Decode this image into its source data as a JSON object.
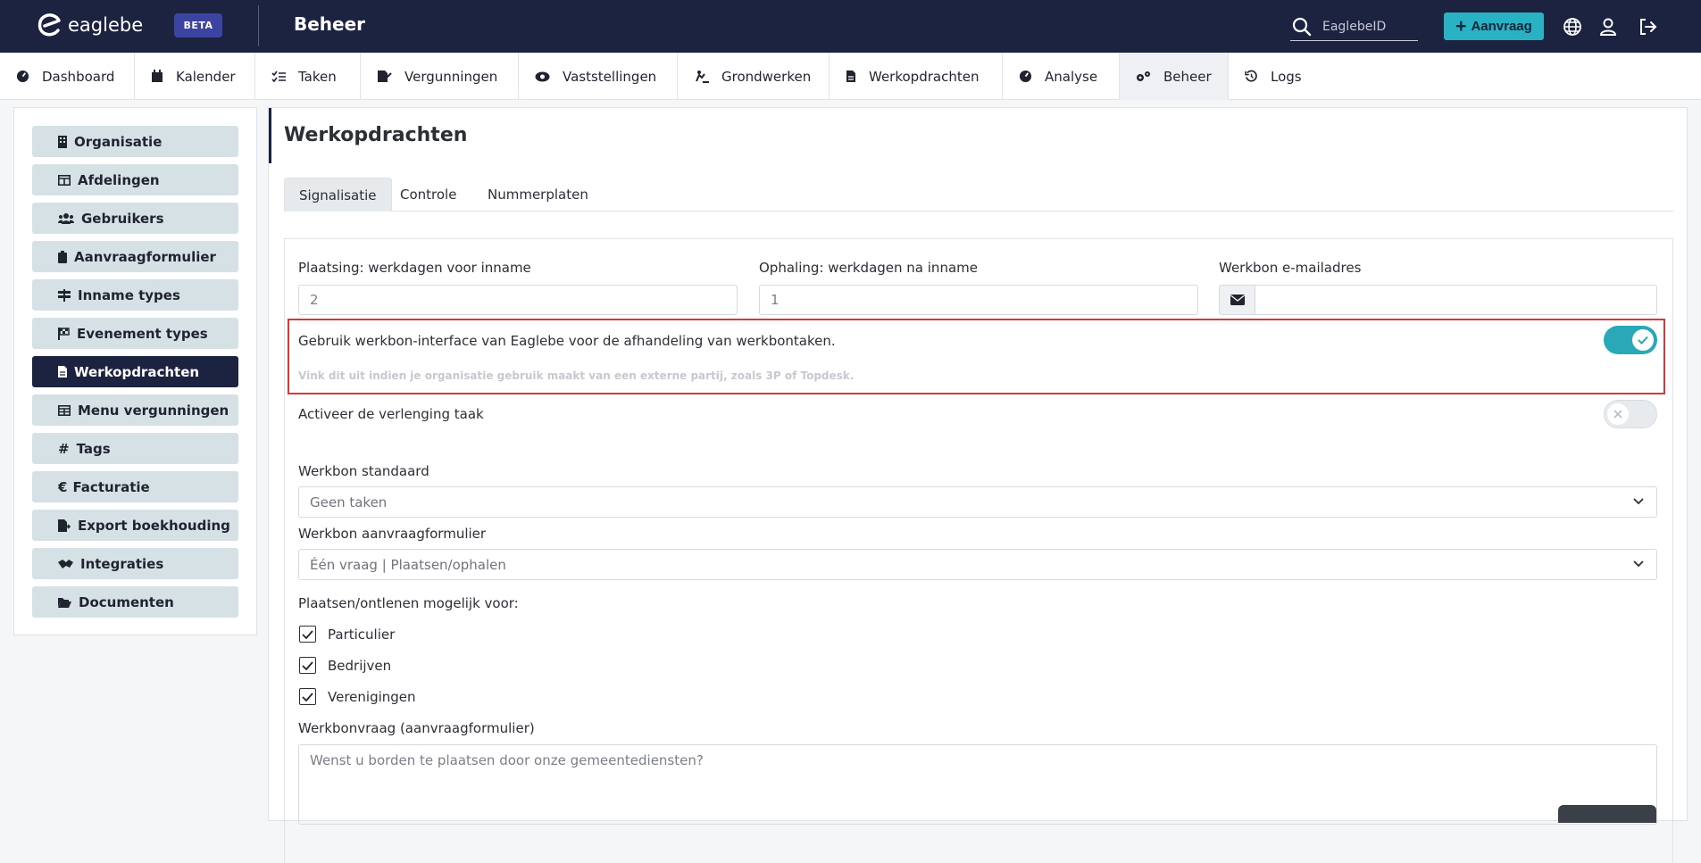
{
  "topbar": {
    "brand": "eaglebe",
    "beta": "BETA",
    "title": "Beheer",
    "search_placeholder": "EaglebeID",
    "aanvraag_label": "Aanvraag"
  },
  "nav": [
    {
      "label": "Dashboard",
      "icon": "gauge-icon"
    },
    {
      "label": "Kalender",
      "icon": "calendar-icon"
    },
    {
      "label": "Taken",
      "icon": "tasks-icon"
    },
    {
      "label": "Vergunningen",
      "icon": "file-signature-icon"
    },
    {
      "label": "Vaststellingen",
      "icon": "eye-icon"
    },
    {
      "label": "Grondwerken",
      "icon": "digging-icon"
    },
    {
      "label": "Werkopdrachten",
      "icon": "document-icon"
    },
    {
      "label": "Analyse",
      "icon": "gauge-icon"
    },
    {
      "label": "Beheer",
      "icon": "cogs-icon",
      "active": true
    },
    {
      "label": "Logs",
      "icon": "history-icon"
    }
  ],
  "sidebar": [
    {
      "label": "Organisatie",
      "icon": "building-icon"
    },
    {
      "label": "Afdelingen",
      "icon": "table-icon"
    },
    {
      "label": "Gebruikers",
      "icon": "users-icon"
    },
    {
      "label": "Aanvraagformulier",
      "icon": "clipboard-icon"
    },
    {
      "label": "Inname types",
      "icon": "signs-icon"
    },
    {
      "label": "Evenement types",
      "icon": "flag-icon"
    },
    {
      "label": "Werkopdrachten",
      "icon": "document-icon",
      "active": true
    },
    {
      "label": "Menu vergunningen",
      "icon": "table-icon"
    },
    {
      "label": "Tags",
      "icon": "hashtag-icon"
    },
    {
      "label": "Facturatie",
      "icon": "euro-icon"
    },
    {
      "label": "Export boekhouding",
      "icon": "file-export-icon"
    },
    {
      "label": "Integraties",
      "icon": "handshake-icon"
    },
    {
      "label": "Documenten",
      "icon": "folder-open-icon"
    }
  ],
  "main": {
    "title": "Werkopdrachten",
    "tabs": [
      "Signalisatie",
      "Controle",
      "Nummerplaten"
    ],
    "plaatsing_label": "Plaatsing: werkdagen voor inname",
    "plaatsing_value": "2",
    "ophaling_label": "Ophaling: werkdagen na inname",
    "ophaling_value": "1",
    "email_label": "Werkbon e-mailadres",
    "email_value": "",
    "interface_label": "Gebruik werkbon-interface van Eaglebe voor de afhandeling van werkbontaken.",
    "interface_hint": "Vink dit uit indien je organisatie gebruik maakt van een externe partij, zoals 3P of Topdesk.",
    "interface_on": true,
    "verlenging_label": "Activeer de verlenging taak",
    "verlenging_on": false,
    "standaard_label": "Werkbon standaard",
    "standaard_value": "Geen taken",
    "aanvraag_label": "Werkbon aanvraagformulier",
    "aanvraag_value": "Één vraag | Plaatsen/ophalen",
    "mogelijk_label": "Plaatsen/ontlenen mogelijk voor:",
    "checkboxes": [
      {
        "label": "Particulier",
        "checked": true
      },
      {
        "label": "Bedrijven",
        "checked": true
      },
      {
        "label": "Verenigingen",
        "checked": true
      }
    ],
    "vraag_label": "Werkbonvraag (aanvraagformulier)",
    "vraag_placeholder": "Wenst u borden te plaatsen door onze gemeentediensten?"
  },
  "colors": {
    "topbar": "#1c2340",
    "accent": "#29b1c4",
    "toggle_on": "#2aa8b8",
    "sidebar_item": "#d6e1e5",
    "highlight": "#d23a3a"
  }
}
